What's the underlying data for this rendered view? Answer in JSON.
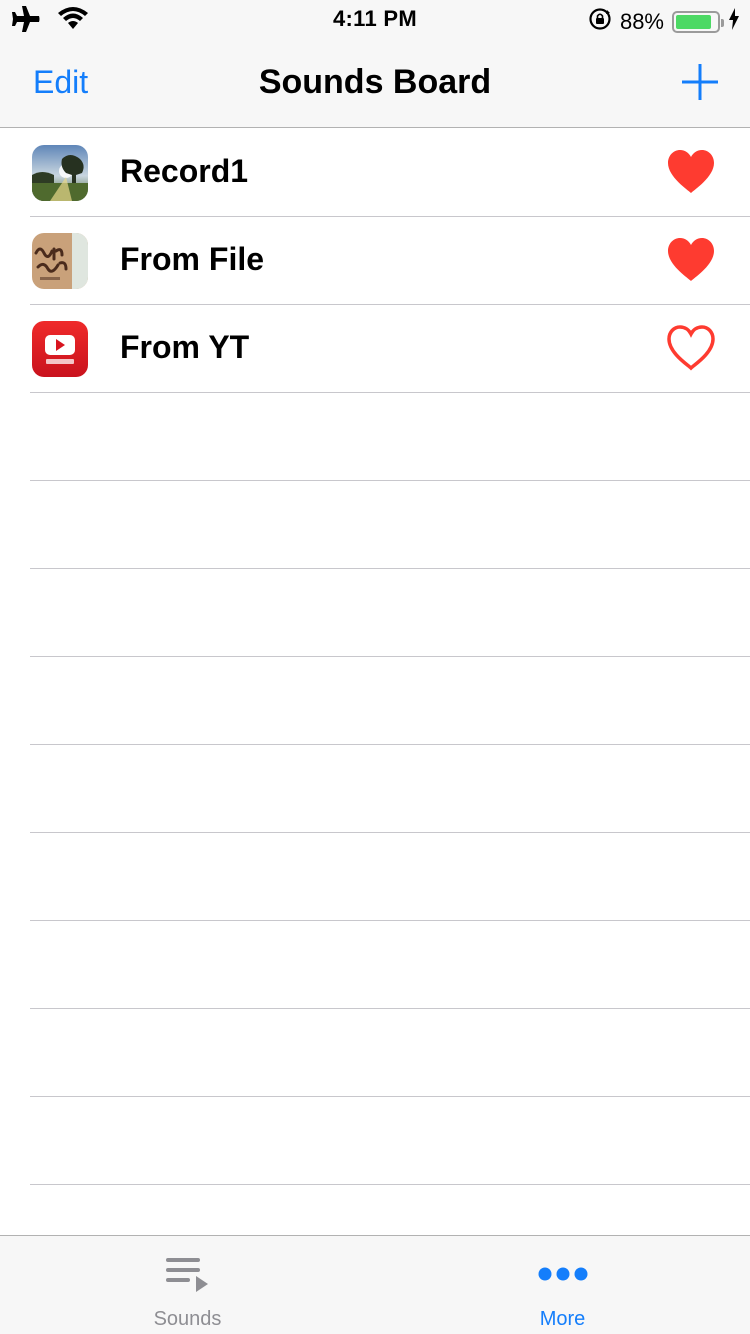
{
  "status_bar": {
    "time": "4:11 PM",
    "battery_percent_label": "88%",
    "battery_level": 0.88,
    "icons": [
      "airplane-icon",
      "wifi-icon",
      "rotation-lock-icon",
      "battery-icon",
      "charging-bolt-icon"
    ]
  },
  "nav": {
    "edit_label": "Edit",
    "title": "Sounds Board",
    "add_icon": "plus-icon"
  },
  "sounds": [
    {
      "label": "Record1",
      "thumbnail": "landscape-photo",
      "favorite": true
    },
    {
      "label": "From File",
      "thumbnail": "lettering-photo",
      "favorite": true
    },
    {
      "label": "From YT",
      "thumbnail": "youtube-logo",
      "favorite": false
    }
  ],
  "tabs": [
    {
      "label": "Sounds",
      "icon": "playlist-icon",
      "selected": false
    },
    {
      "label": "More",
      "icon": "more-dots-icon",
      "selected": true
    }
  ],
  "colors": {
    "accent": "#147efb",
    "heart": "#fe3b30",
    "tab_inactive": "#8e8e93",
    "battery": "#4cd964",
    "separator": "#c8c7cc",
    "bar_background": "#f7f7f7"
  }
}
